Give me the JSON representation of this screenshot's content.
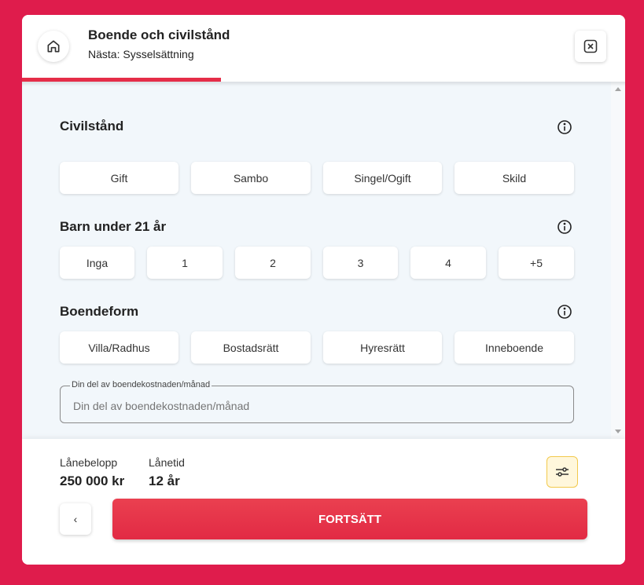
{
  "header": {
    "title": "Boende och civilstånd",
    "subtitle": "Nästa: Sysselsättning",
    "progress_fraction": 0.33
  },
  "sections": {
    "civilstand": {
      "title": "Civilstånd",
      "options": [
        "Gift",
        "Sambo",
        "Singel/Ogift",
        "Skild"
      ]
    },
    "barn": {
      "title": "Barn under 21 år",
      "options": [
        "Inga",
        "1",
        "2",
        "3",
        "4",
        "+5"
      ]
    },
    "boendeform": {
      "title": "Boendeform",
      "options": [
        "Villa/Radhus",
        "Bostadsrätt",
        "Hyresrätt",
        "Inneboende"
      ]
    }
  },
  "housing_cost": {
    "label": "Din del av boendekostnaden/månad",
    "placeholder": "Din del av boendekostnaden/månad"
  },
  "footer": {
    "loan_amount_label": "Lånebelopp",
    "loan_amount_value": "250 000 kr",
    "loan_term_label": "Lånetid",
    "loan_term_value": "12 år",
    "back_label": "‹",
    "continue_label": "FORTSÄTT"
  },
  "colors": {
    "background": "#df1c4c",
    "accent": "#e52d48",
    "panel": "#f2f7fb"
  },
  "icons": [
    "home-icon",
    "close-icon",
    "info-icon",
    "sliders-icon",
    "chevron-left-icon"
  ]
}
